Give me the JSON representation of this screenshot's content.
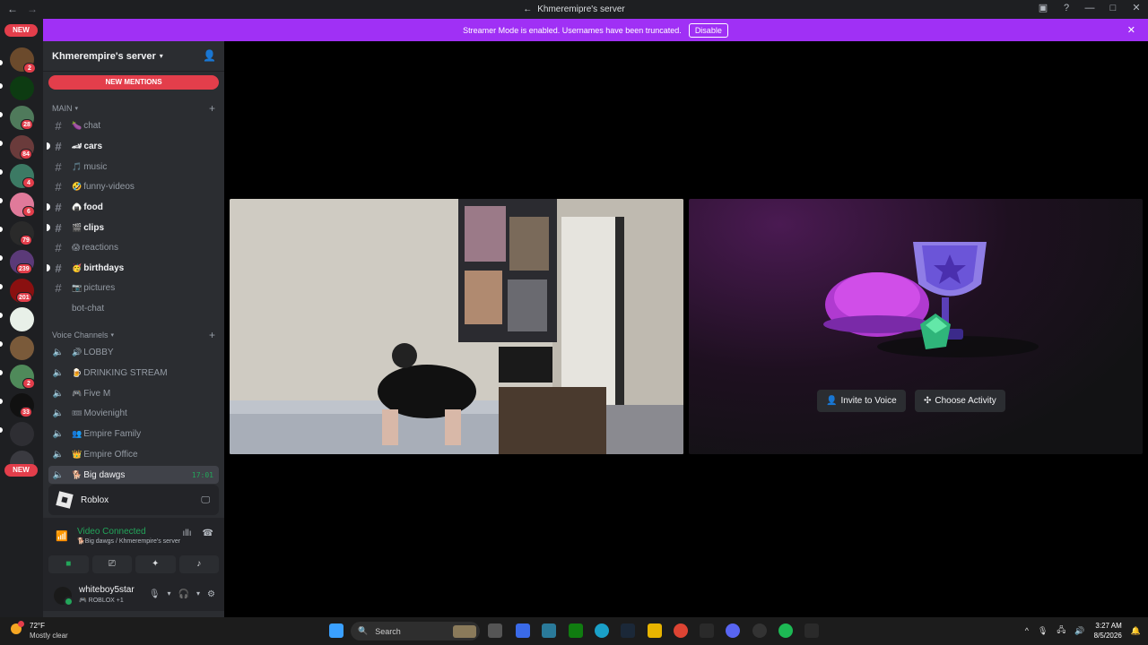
{
  "window": {
    "title": "Khmeremipre's server"
  },
  "rail": {
    "new_top": "NEW",
    "new_bottom": "NEW",
    "badges": [
      "2",
      "28",
      "84",
      "4",
      "6",
      "79",
      "239",
      "201",
      "2",
      "33"
    ]
  },
  "server": {
    "name": "Khmerempire's server",
    "new_mentions": "NEW MENTIONS"
  },
  "categories": {
    "main": "MAIN",
    "voice": "Voice Channels"
  },
  "text_channels": [
    {
      "emoji": "🍆",
      "name": "chat"
    },
    {
      "emoji": "🏎",
      "name": "cars"
    },
    {
      "emoji": "🎵",
      "name": "music"
    },
    {
      "emoji": "🤣",
      "name": "funny-videos"
    },
    {
      "emoji": "🍙",
      "name": "food"
    },
    {
      "emoji": "🎬",
      "name": "clips"
    },
    {
      "emoji": "😱",
      "name": "reactions"
    },
    {
      "emoji": "🥳",
      "name": "birthdays"
    },
    {
      "emoji": "📷",
      "name": "pictures"
    },
    {
      "emoji": "",
      "name": "bot-chat"
    }
  ],
  "voice_channels": [
    {
      "emoji": "🔊",
      "name": "LOBBY"
    },
    {
      "emoji": "🍺",
      "name": "DRINKING STREAM"
    },
    {
      "emoji": "🎮",
      "name": "Five M"
    },
    {
      "emoji": "🎟",
      "name": "Movienight"
    },
    {
      "emoji": "👥",
      "name": "Empire Family"
    },
    {
      "emoji": "👑",
      "name": "Empire Office"
    },
    {
      "emoji": "🐕",
      "name": "Big dawgs",
      "timer": "17:01"
    }
  ],
  "activity": {
    "name": "Roblox"
  },
  "voice": {
    "status": "Video Connected",
    "location": "🐕Big dawgs / Khmerempire's server"
  },
  "user": {
    "name": "whiteboy5star",
    "status": "🎮 ROBLOX +1"
  },
  "banner": {
    "text": "Streamer Mode is enabled. Usernames have been truncated.",
    "disable": "Disable"
  },
  "stage": {
    "invite_label": "Invite to Voice",
    "activity_label": "Choose Activity"
  },
  "taskbar": {
    "temp": "72°F",
    "weather": "Mostly clear",
    "search": "Search",
    "time": "3:27 AM",
    "date": "8/5/2026"
  },
  "colors": {
    "banner": "#a030f5",
    "mention": "#e33e4b",
    "connected": "#23a55a"
  }
}
